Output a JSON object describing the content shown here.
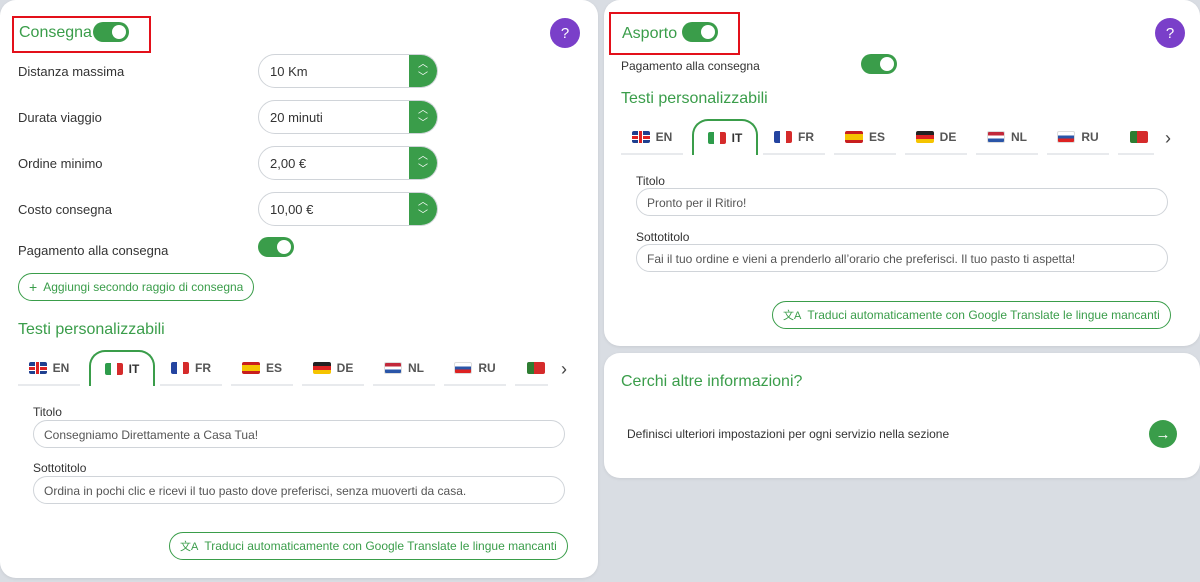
{
  "colors": {
    "accent": "#3a9d4a",
    "help": "#7a3fc9",
    "highlight": "#e3101a"
  },
  "delivery": {
    "title": "Consegna",
    "help_icon": "?",
    "rows": [
      {
        "label": "Distanza massima",
        "value": "10 Km"
      },
      {
        "label": "Durata viaggio",
        "value": "20 minuti"
      },
      {
        "label": "Ordine minimo",
        "value": "2,00 €"
      },
      {
        "label": "Costo consegna",
        "value": "10,00 €"
      }
    ],
    "cash_on_delivery_label": "Pagamento alla consegna",
    "add_radius_label": "Aggiungi secondo raggio di consegna",
    "custom_texts_title": "Testi personalizzabili",
    "title_label": "Titolo",
    "title_value": "Consegniamo Direttamente a Casa Tua!",
    "subtitle_label": "Sottotitolo",
    "subtitle_value": "Ordina in pochi clic e ricevi il tuo pasto dove preferisci, senza muoverti da casa.",
    "translate_label": "Traduci automaticamente con Google Translate le lingue mancanti"
  },
  "takeaway": {
    "title": "Asporto",
    "help_icon": "?",
    "cash_on_delivery_label": "Pagamento alla consegna",
    "custom_texts_title": "Testi personalizzabili",
    "title_label": "Titolo",
    "title_value": "Pronto per il Ritiro!",
    "subtitle_label": "Sottotitolo",
    "subtitle_value": "Fai il tuo ordine e vieni a prenderlo all’orario che preferisci. Il tuo pasto ti aspetta!",
    "translate_label": "Traduci automaticamente con Google Translate le lingue mancanti"
  },
  "languages": [
    "EN",
    "IT",
    "FR",
    "ES",
    "DE",
    "NL",
    "RU"
  ],
  "active_language": "IT",
  "info": {
    "title": "Cerchi altre informazioni?",
    "text": "Definisci ulteriori impostazioni per ogni servizio nella sezione"
  }
}
